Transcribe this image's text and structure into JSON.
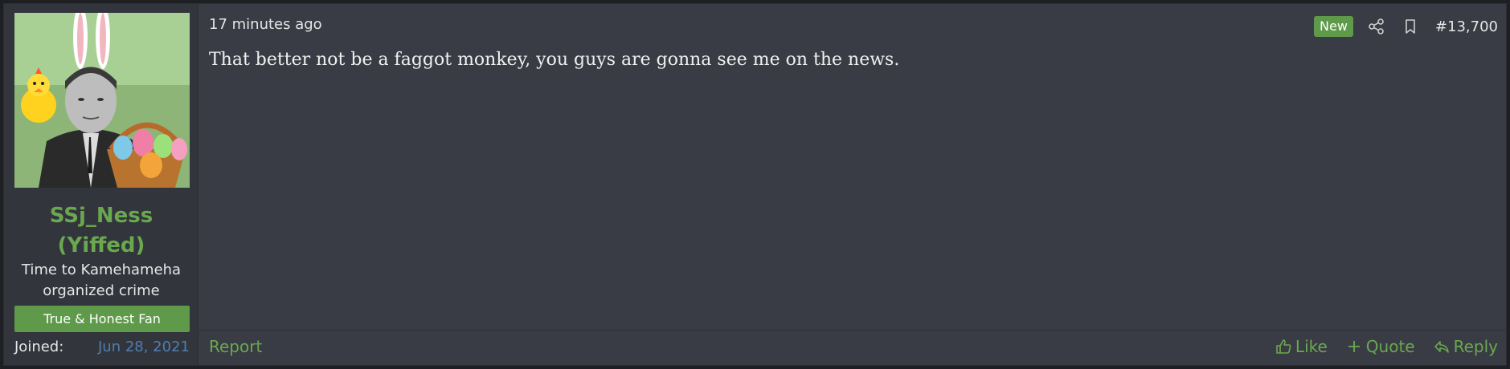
{
  "user": {
    "username_line1": "SSj_Ness",
    "username_line2": "(Yiffed)",
    "title_line1": "Time to Kamehameha",
    "title_line2": "organized crime",
    "banner": "True & Honest Fan",
    "joined_label": "Joined:",
    "joined_value": "Jun 28, 2021"
  },
  "post": {
    "timestamp": "17 minutes ago",
    "new_badge": "New",
    "number": "#13,700",
    "message": "That better not be a faggot monkey, you guys are gonna see me on the news."
  },
  "footer": {
    "report": "Report",
    "like": "Like",
    "quote": "Quote",
    "reply": "Reply"
  },
  "icons": {
    "share": "share-icon",
    "bookmark": "bookmark-icon",
    "like": "thumbs-up-icon",
    "quote": "plus-icon",
    "reply": "reply-icon"
  },
  "colors": {
    "accent": "#6aa84f",
    "link": "#4f7fb0",
    "post_bg": "#393c44",
    "user_bg": "#32353c"
  }
}
